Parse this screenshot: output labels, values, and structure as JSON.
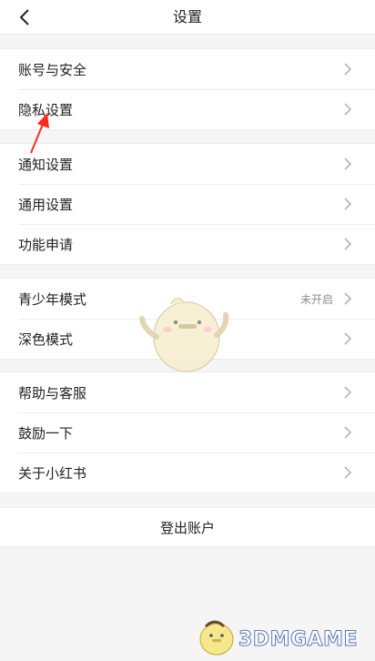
{
  "header": {
    "title": "设置"
  },
  "groups": [
    {
      "items": [
        {
          "label": "账号与安全"
        },
        {
          "label": "隐私设置"
        }
      ]
    },
    {
      "items": [
        {
          "label": "通知设置"
        },
        {
          "label": "通用设置"
        },
        {
          "label": "功能申请"
        }
      ]
    },
    {
      "items": [
        {
          "label": "青少年模式",
          "value": "未开启"
        },
        {
          "label": "深色模式"
        }
      ]
    },
    {
      "items": [
        {
          "label": "帮助与客服"
        },
        {
          "label": "鼓励一下"
        },
        {
          "label": "关于小红书"
        }
      ]
    }
  ],
  "logout": {
    "label": "登出账户"
  },
  "watermark": {
    "text": "3DMGAME"
  },
  "colors": {
    "annotation": "#ff2a1a",
    "chevron": "#b3b3b3",
    "background": "#f5f5f5"
  }
}
